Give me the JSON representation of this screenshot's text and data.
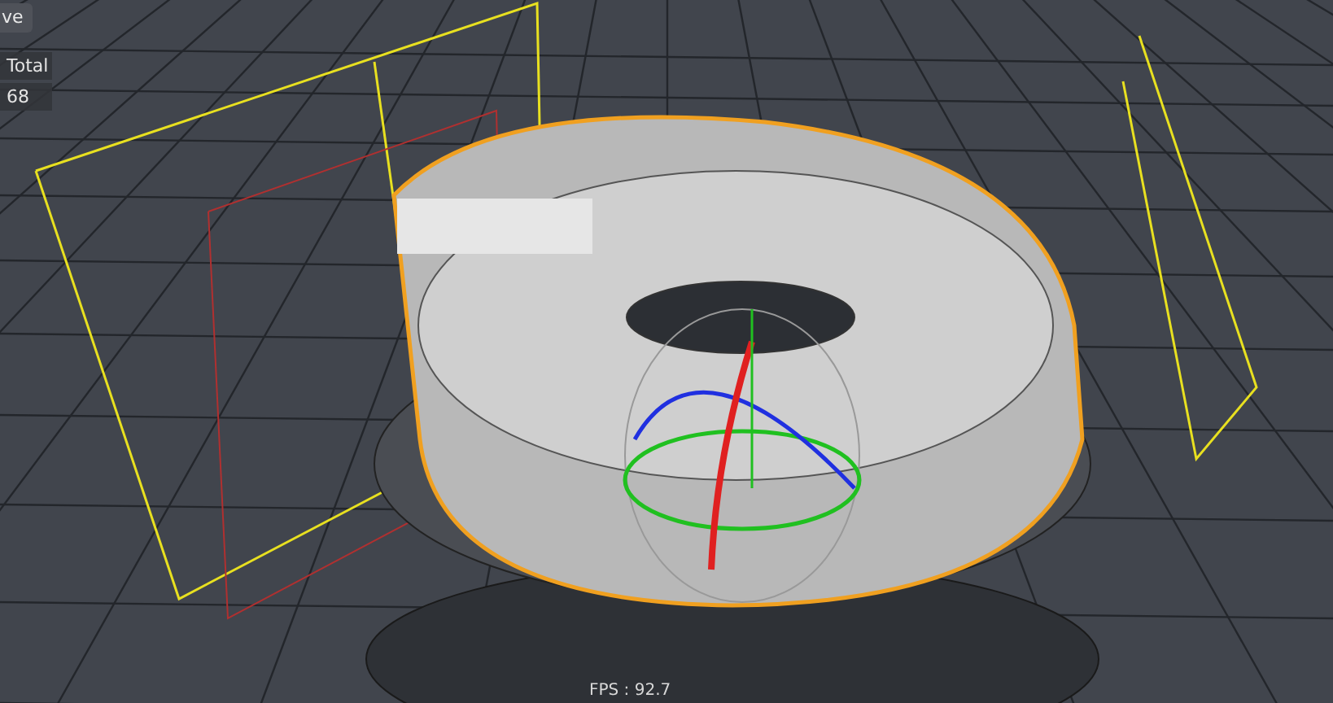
{
  "viewport": {
    "tab_label": "ve",
    "stats": {
      "label": "Total",
      "value": "68"
    },
    "fps": "FPS : 92.7"
  }
}
